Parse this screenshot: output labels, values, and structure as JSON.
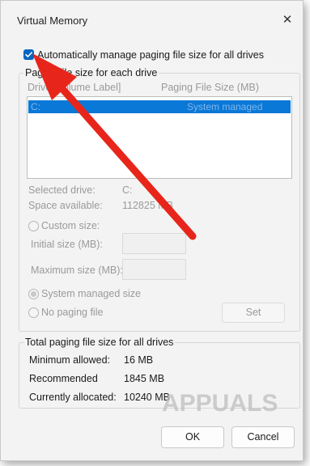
{
  "window": {
    "title": "Virtual Memory",
    "close_glyph": "✕"
  },
  "auto_manage": {
    "label": "Automatically manage paging file size for all drives",
    "checked": true
  },
  "per_drive": {
    "legend": "Paging file size for each drive",
    "col_drive": "Drive [Volume Label]",
    "col_size": "Paging File Size (MB)",
    "rows": [
      {
        "drive": "C:",
        "size": "System managed"
      }
    ],
    "selected_drive_label": "Selected drive:",
    "selected_drive_value": "C:",
    "space_available_label": "Space available:",
    "space_available_value": "112825 MB",
    "custom_size_label": "Custom size:",
    "initial_size_label": "Initial size (MB):",
    "maximum_size_label": "Maximum size (MB):",
    "system_managed_label": "System managed size",
    "no_paging_label": "No paging file",
    "set_button": "Set"
  },
  "totals": {
    "legend": "Total paging file size for all drives",
    "min_label": "Minimum allowed:",
    "min_value": "16 MB",
    "rec_label": "Recommended",
    "rec_value": "1845 MB",
    "cur_label": "Currently allocated:",
    "cur_value": "10240 MB"
  },
  "buttons": {
    "ok": "OK",
    "cancel": "Cancel"
  },
  "watermark": {
    "text": "APPUALS"
  },
  "colors": {
    "accent": "#0067c0",
    "selection": "#0a78d7",
    "arrow": "#e8251b"
  }
}
